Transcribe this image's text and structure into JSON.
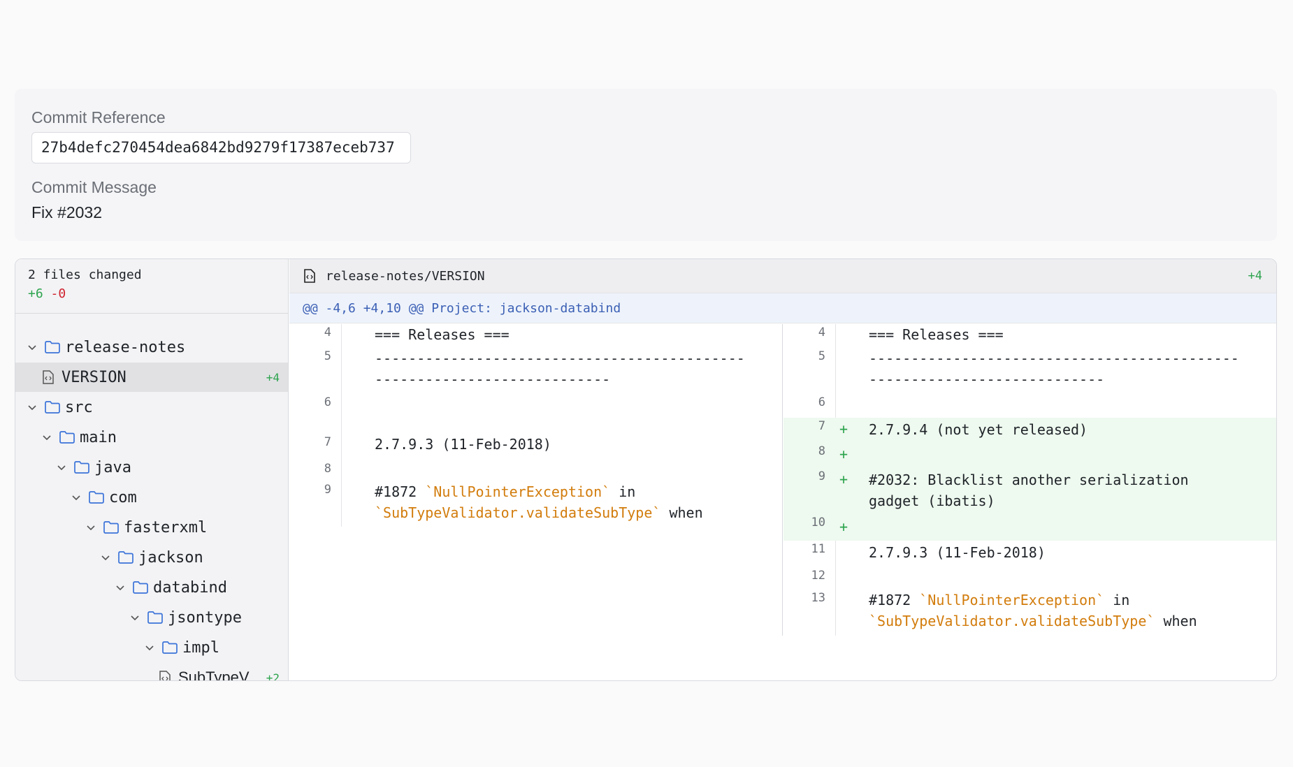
{
  "commit": {
    "reference_label": "Commit Reference",
    "reference_value": "27b4defc270454dea6842bd9279f17387eceb737",
    "message_label": "Commit Message",
    "message_value": "Fix #2032"
  },
  "sidebar": {
    "files_changed": "2 files changed",
    "additions": "+6",
    "deletions": "-0",
    "tree": [
      {
        "label": "release-notes",
        "type": "folder"
      },
      {
        "label": "VERSION",
        "type": "file",
        "count": "+4",
        "selected": true
      },
      {
        "label": "src",
        "type": "folder"
      },
      {
        "label": "main",
        "type": "folder"
      },
      {
        "label": "java",
        "type": "folder"
      },
      {
        "label": "com",
        "type": "folder"
      },
      {
        "label": "fasterxml",
        "type": "folder"
      },
      {
        "label": "jackson",
        "type": "folder"
      },
      {
        "label": "databind",
        "type": "folder"
      },
      {
        "label": "jsontype",
        "type": "folder"
      },
      {
        "label": "impl",
        "type": "folder"
      },
      {
        "label": "SubTypeV…",
        "type": "file",
        "count": "+2"
      }
    ]
  },
  "diff": {
    "file_path": "release-notes/VERSION",
    "file_count": "+4",
    "hunk_header": "@@ -4,6 +4,10 @@ Project: jackson-databind",
    "left": {
      "lines": [
        {
          "num": "4",
          "text": "=== Releases ==="
        },
        {
          "num": "5",
          "text1": "--------------------------------------------",
          "text2": "----------------------------"
        },
        {
          "num": "6",
          "text": ""
        },
        {
          "num": "7",
          "text": "2.7.9.3 (11-Feb-2018)"
        },
        {
          "num": "8",
          "text": ""
        },
        {
          "num": "9",
          "pre": "#1872 ",
          "tok1": "`NullPointerException`",
          "mid": " in",
          "tok2": "`SubTypeValidator.validateSubType`",
          "post": " when"
        }
      ]
    },
    "right": {
      "lines": [
        {
          "num": "4",
          "text": "=== Releases ==="
        },
        {
          "num": "5",
          "text1": "--------------------------------------------",
          "text2": "----------------------------"
        },
        {
          "num": "6",
          "text": ""
        },
        {
          "num": "7",
          "sign": "+",
          "text": "2.7.9.4 (not yet released)"
        },
        {
          "num": "8",
          "sign": "+",
          "text": ""
        },
        {
          "num": "9",
          "sign": "+",
          "text1": "#2032: Blacklist another serialization",
          "text2": "gadget (ibatis)"
        },
        {
          "num": "10",
          "sign": "+",
          "text": ""
        },
        {
          "num": "11",
          "text": "2.7.9.3 (11-Feb-2018)"
        },
        {
          "num": "12",
          "text": ""
        },
        {
          "num": "13",
          "pre": "#1872 ",
          "tok1": "`NullPointerException`",
          "mid": " in",
          "tok2": "`SubTypeValidator.validateSubType`",
          "post": " when"
        }
      ]
    }
  }
}
